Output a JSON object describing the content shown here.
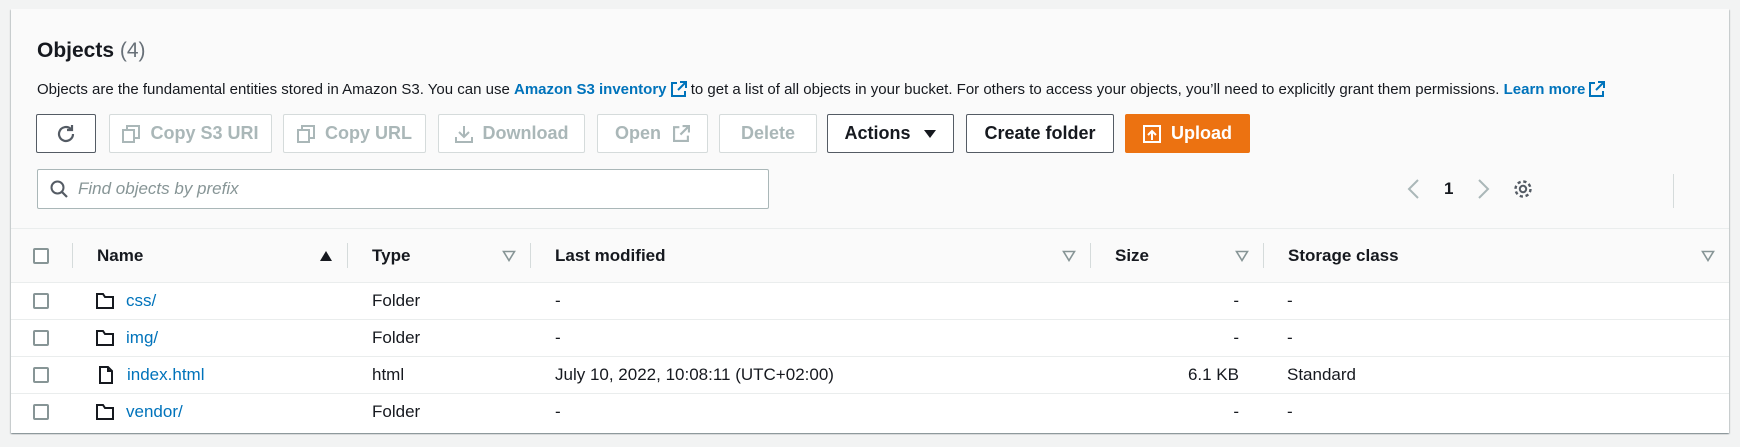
{
  "header": {
    "title": "Objects",
    "count": "(4)",
    "description_pre": "Objects are the fundamental entities stored in Amazon S3. You can use",
    "inventory_link": "Amazon S3 inventory",
    "description_mid": "to get a list of all objects in your bucket. For others to access your objects, you’ll need to explicitly grant them permissions.",
    "learn_more": "Learn more"
  },
  "toolbar": {
    "copy_s3_uri": "Copy S3 URI",
    "copy_url": "Copy URL",
    "download": "Download",
    "open": "Open",
    "delete": "Delete",
    "actions": "Actions",
    "create_folder": "Create folder",
    "upload": "Upload"
  },
  "search": {
    "placeholder": "Find objects by prefix",
    "value": ""
  },
  "pagination": {
    "current_page": "1"
  },
  "table": {
    "columns": {
      "name": "Name",
      "type": "Type",
      "last_modified": "Last modified",
      "size": "Size",
      "storage_class": "Storage class"
    },
    "rows": [
      {
        "name": "css/",
        "type": "Folder",
        "last_modified": "-",
        "size": "-",
        "storage_class": "-",
        "icon": "folder-icon"
      },
      {
        "name": "img/",
        "type": "Folder",
        "last_modified": "-",
        "size": "-",
        "storage_class": "-",
        "icon": "folder-icon"
      },
      {
        "name": "index.html",
        "type": "html",
        "last_modified": "July 10, 2022, 10:08:11 (UTC+02:00)",
        "size": "6.1 KB",
        "storage_class": "Standard",
        "icon": "file-icon"
      },
      {
        "name": "vendor/",
        "type": "Folder",
        "last_modified": "-",
        "size": "-",
        "storage_class": "-",
        "icon": "folder-icon"
      }
    ]
  },
  "colors": {
    "link": "#0073bb",
    "primary": "#ec7211",
    "disabled_text": "#aab7b8",
    "text": "#16191f"
  }
}
